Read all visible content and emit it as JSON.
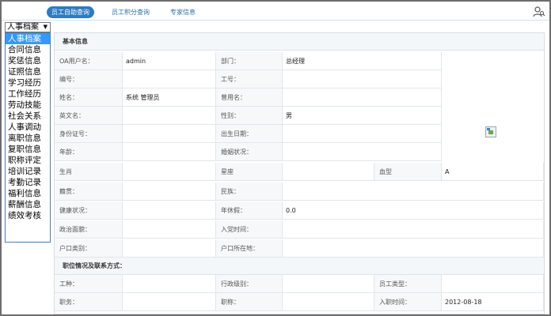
{
  "tabs": [
    {
      "label": "员工自助查询",
      "active": true
    },
    {
      "label": "员工积分查询",
      "active": false
    },
    {
      "label": "专家信息",
      "active": false
    }
  ],
  "category_select": {
    "value": "人事档案"
  },
  "category_list": [
    "人事档案",
    "合同信息",
    "奖惩信息",
    "证照信息",
    "学习经历",
    "工作经历",
    "劳动技能",
    "社会关系",
    "人事调动",
    "离职信息",
    "复职信息",
    "职称评定",
    "培训记录",
    "考勤记录",
    "福利信息",
    "薪酬信息",
    "绩效考核"
  ],
  "selected_index": 0,
  "sections": {
    "basic": "基本信息",
    "position": "职位情况及联系方式："
  },
  "fields": {
    "oa_user_label": "OA用户名：",
    "oa_user_value": "admin",
    "dept_label": "部门：",
    "dept_value": "总经理",
    "number_label": "编号：",
    "number_value": "",
    "job_no_label": "工号：",
    "job_no_value": "",
    "name_label": "姓名：",
    "name_value": "系统 管理员",
    "former_name_label": "曾用名：",
    "former_name_value": "",
    "english_name_label": "英文名：",
    "english_name_value": "",
    "gender_label": "性别：",
    "gender_value": "男",
    "id_card_label": "身份证号：",
    "id_card_value": "",
    "birth_date_label": "出生日期：",
    "birth_date_value": "",
    "age_label": "年龄：",
    "age_value": "",
    "marital_label": "婚姻状况：",
    "marital_value": "",
    "zodiac_label": "生肖",
    "zodiac_value": "",
    "constellation_label": "星座",
    "constellation_value": "",
    "blood_label": "血型",
    "blood_value": "A",
    "native_label": "籍贯：",
    "native_value": "",
    "ethnic_label": "民族：",
    "ethnic_value": "",
    "health_label": "健康状况：",
    "health_value": "",
    "annual_leave_label": "年休假：",
    "annual_leave_value": "0.0",
    "political_label": "政治面貌：",
    "political_value": "",
    "party_date_label": "入党时间：",
    "party_date_value": "",
    "hukou_type_label": "户口类别：",
    "hukou_type_value": "",
    "hukou_place_label": "户口所在地：",
    "hukou_place_value": "",
    "job_type_label": "工种：",
    "job_type_value": "",
    "admin_level_label": "行政级别：",
    "admin_level_value": "",
    "emp_type_label": "员工类型：",
    "emp_type_value": "",
    "post_label": "职务：",
    "post_value": "",
    "title_label": "职称：",
    "title_value": "",
    "hire_date_label": "入职时间：",
    "hire_date_value": "2012-08-18"
  },
  "icons": {
    "user_search": "user-search-icon",
    "photo": "broken-image-icon"
  }
}
